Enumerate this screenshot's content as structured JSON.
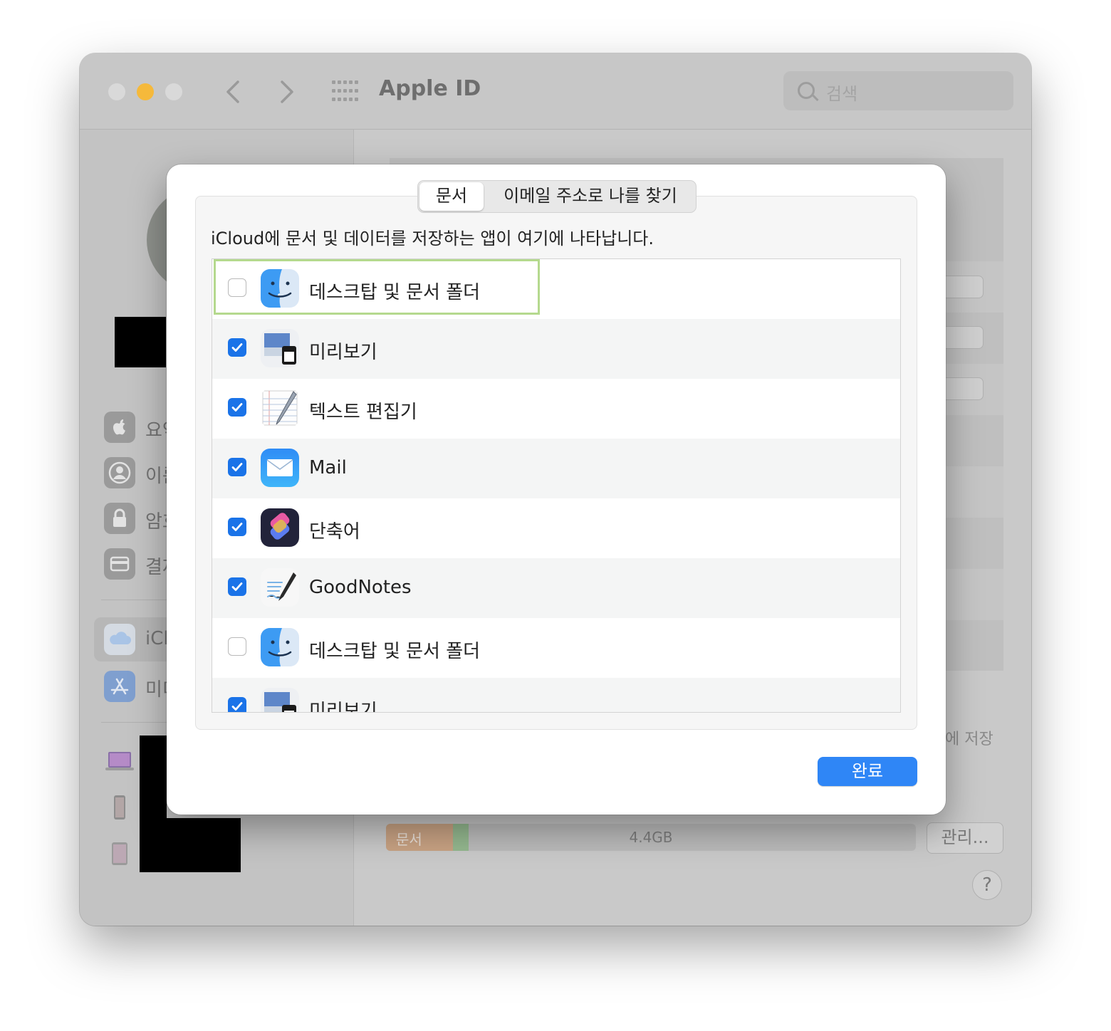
{
  "window": {
    "title": "Apple ID",
    "search_placeholder": "검색",
    "traffic_lights": [
      "#d9d9d9",
      "#f5b93b",
      "#d9d9d9"
    ]
  },
  "sidebar": {
    "items": [
      {
        "label": "요약",
        "icon": "apple-icon"
      },
      {
        "label": "이름",
        "icon": "person-icon"
      },
      {
        "label": "암호",
        "icon": "lock-icon"
      },
      {
        "label": "결제",
        "icon": "card-icon"
      },
      {
        "label": "iCloud",
        "icon": "cloud-icon"
      },
      {
        "label": "미디어",
        "icon": "app-store-icon"
      }
    ],
    "devices": [
      {
        "icon": "macbook-icon"
      },
      {
        "icon": "iphone-icon"
      },
      {
        "icon": "ipad-icon"
      }
    ]
  },
  "main": {
    "background_text": "에 저장",
    "storage": {
      "docs_label": "문서",
      "total": "4.4GB"
    },
    "manage_label": "관리...",
    "help_label": "?"
  },
  "modal": {
    "tabs": [
      {
        "label": "문서",
        "active": true
      },
      {
        "label": "이메일 주소로 나를 찾기",
        "active": false
      }
    ],
    "description": "iCloud에 문서 및 데이터를 저장하는 앱이 여기에 나타납니다.",
    "apps": [
      {
        "name": "데스크탑 및 문서 폴더",
        "checked": false,
        "icon": "finder-icon"
      },
      {
        "name": "미리보기",
        "checked": true,
        "icon": "preview-icon"
      },
      {
        "name": "텍스트 편집기",
        "checked": true,
        "icon": "textedit-icon"
      },
      {
        "name": "Mail",
        "checked": true,
        "icon": "mail-icon"
      },
      {
        "name": "단축어",
        "checked": true,
        "icon": "shortcuts-icon"
      },
      {
        "name": "GoodNotes",
        "checked": true,
        "icon": "goodnotes-icon"
      },
      {
        "name": "데스크탑 및 문서 폴더",
        "checked": false,
        "icon": "finder-icon"
      },
      {
        "name": "미리보기",
        "checked": true,
        "icon": "preview-icon"
      }
    ],
    "done_label": "완료",
    "accent_color": "#2f86f6",
    "focus_color": "#b5d98e"
  }
}
